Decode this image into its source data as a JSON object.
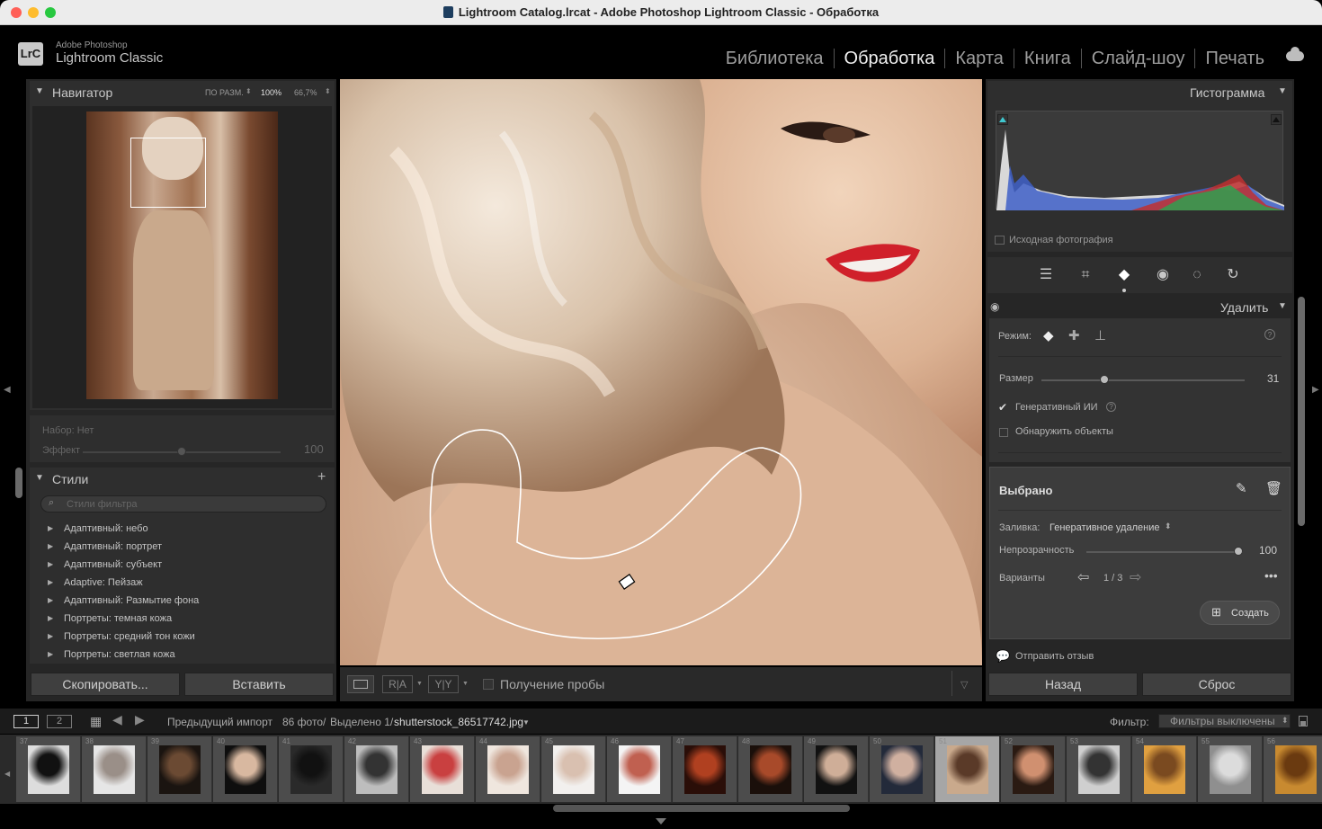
{
  "window": {
    "title": "Lightroom Catalog.lrcat - Adobe Photoshop Lightroom Classic - Обработка"
  },
  "brand": {
    "line1": "Adobe Photoshop",
    "line2": "Lightroom Classic",
    "badge": "LrC"
  },
  "modules": [
    {
      "label": "Библиотека",
      "active": false
    },
    {
      "label": "Обработка",
      "active": true
    },
    {
      "label": "Карта",
      "active": false
    },
    {
      "label": "Книга",
      "active": false
    },
    {
      "label": "Слайд-шоу",
      "active": false
    },
    {
      "label": "Печать",
      "active": false
    }
  ],
  "navigator": {
    "title": "Навигатор",
    "zoom_fit": "ПО РАЗМ.",
    "zoom_100": "100%",
    "zoom_cur": "66,7%"
  },
  "preset": {
    "label": "Набор: Нет",
    "effect_label": "Эффект",
    "effect_value": "100"
  },
  "styles": {
    "title": "Стили",
    "search_placeholder": "Стили фильтра",
    "items": [
      "Адаптивный: небо",
      "Адаптивный: портрет",
      "Адаптивный: субъект",
      "Adaptive: Пейзаж",
      "Адаптивный: Размытие фона",
      "Портреты: темная кожа",
      "Портреты: средний тон кожи",
      "Портреты: светлая кожа"
    ]
  },
  "left_buttons": {
    "copy": "Скопировать...",
    "paste": "Вставить"
  },
  "toolbar": {
    "sample_label": "Получение пробы"
  },
  "histogram": {
    "title": "Гистограмма",
    "original_label": "Исходная фотография"
  },
  "remove": {
    "title": "Удалить",
    "mode_label": "Режим:",
    "size_label": "Размер",
    "size_value": "31",
    "generative_label": "Генеративный ИИ",
    "generative_checked": true,
    "detect_label": "Обнаружить объекты",
    "detect_checked": false
  },
  "selected": {
    "title": "Выбрано",
    "fill_label": "Заливка:",
    "fill_value": "Генеративное удаление",
    "opacity_label": "Непрозрачность",
    "opacity_value": "100",
    "variants_label": "Варианты",
    "variants_value": "1 / 3",
    "create_label": "Создать"
  },
  "feedback": "Отправить отзыв",
  "right_buttons": {
    "back": "Назад",
    "reset": "Сброс"
  },
  "filmstrip_bar": {
    "view1": "1",
    "view2": "2",
    "source": "Предыдущий импорт",
    "count": "86 фото/",
    "selected": "Выделено 1/",
    "filename": "shutterstock_86517742.jpg",
    "filter_label": "Фильтр:",
    "filter_value": "Фильтры выключены"
  },
  "filmstrip": [
    {
      "num": "37",
      "bg": "#ddd",
      "fg": "#111"
    },
    {
      "num": "38",
      "bg": "#e6e6e6",
      "fg": "#9a8f88"
    },
    {
      "num": "39",
      "bg": "#1a1410",
      "fg": "#6b4a33"
    },
    {
      "num": "40",
      "bg": "#0e0e0e",
      "fg": "#d8b8a0"
    },
    {
      "num": "41",
      "bg": "#2a2a2a",
      "fg": "#111"
    },
    {
      "num": "42",
      "bg": "#bdbdbd",
      "fg": "#333"
    },
    {
      "num": "43",
      "bg": "#e8dfd8",
      "fg": "#c94040"
    },
    {
      "num": "44",
      "bg": "#efe6de",
      "fg": "#c9a390"
    },
    {
      "num": "45",
      "bg": "#f2f0ee",
      "fg": "#d9c0b0"
    },
    {
      "num": "46",
      "bg": "#f4f4f4",
      "fg": "#c06050"
    },
    {
      "num": "47",
      "bg": "#2a0e08",
      "fg": "#b04020"
    },
    {
      "num": "48",
      "bg": "#1a0f0a",
      "fg": "#a84a2a"
    },
    {
      "num": "49",
      "bg": "#111",
      "fg": "#cfae98"
    },
    {
      "num": "50",
      "bg": "#232a3a",
      "fg": "#d0b0a0"
    },
    {
      "num": "51",
      "bg": "#c9a98c",
      "fg": "#5a3a28"
    },
    {
      "num": "52",
      "bg": "#2a1a12",
      "fg": "#d09070"
    },
    {
      "num": "53",
      "bg": "#cfcfcf",
      "fg": "#333"
    },
    {
      "num": "54",
      "bg": "#e0a040",
      "fg": "#7a4a20"
    },
    {
      "num": "55",
      "bg": "#8f8f8f",
      "fg": "#dcdcdc"
    },
    {
      "num": "56",
      "bg": "#c88a30",
      "fg": "#6a3a10"
    }
  ],
  "colors": {
    "accent_red": "#ff5f57",
    "accent_yellow": "#febc2e",
    "accent_green": "#28c840"
  }
}
